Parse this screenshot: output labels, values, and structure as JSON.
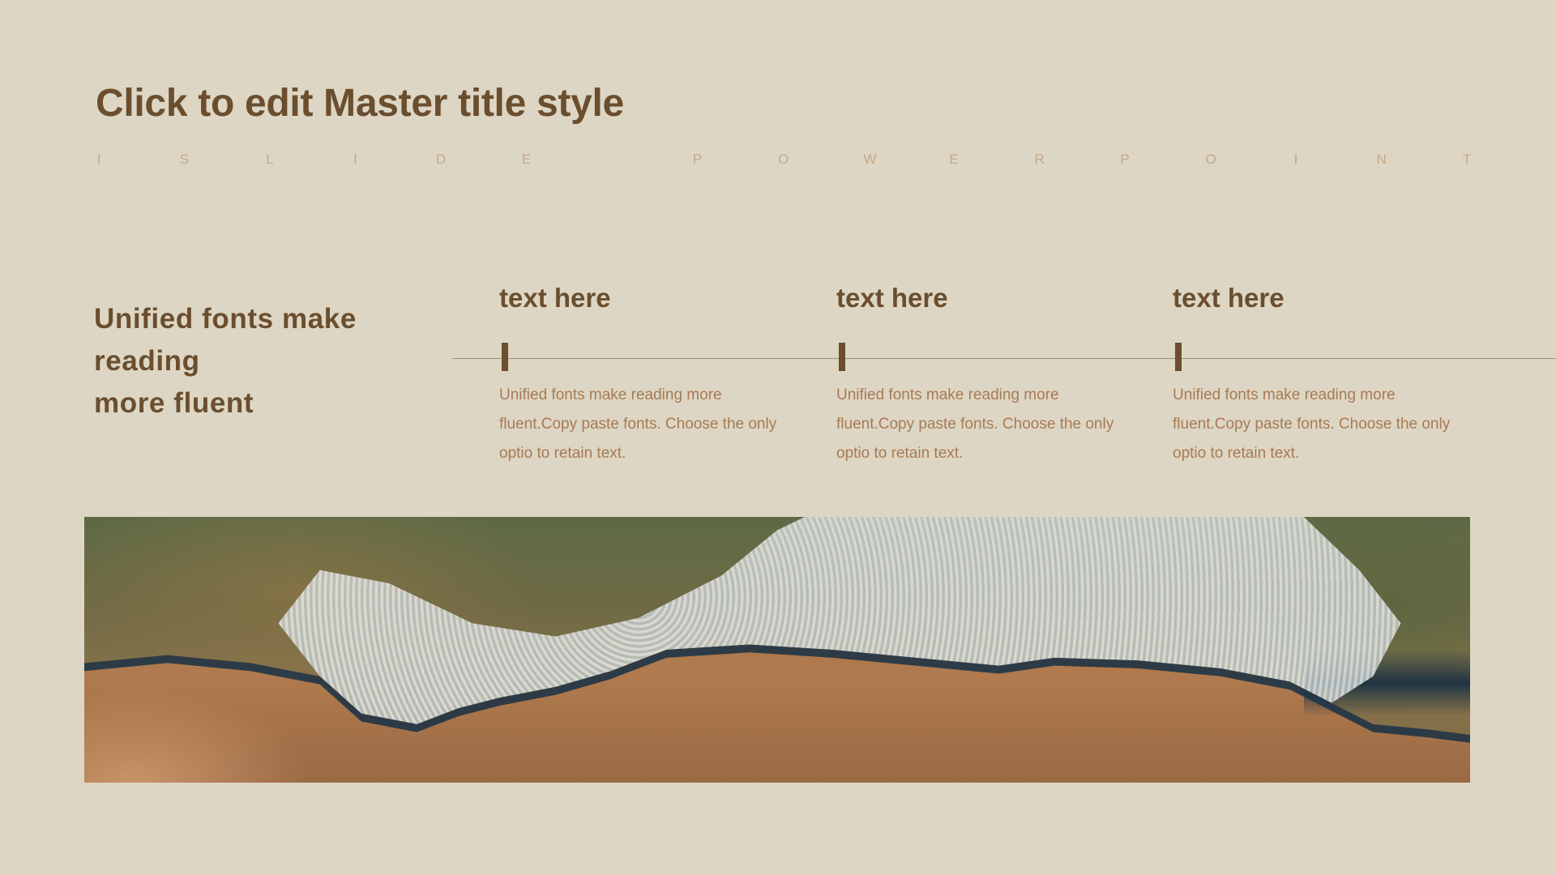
{
  "slide": {
    "title": "Click to edit Master title style",
    "subtitle_letters": [
      "I",
      "S",
      "L",
      "I",
      "D",
      "E",
      " ",
      "P",
      "O",
      "W",
      "E",
      "R",
      "P",
      "O",
      "I",
      "N",
      "T"
    ],
    "lead_lines": [
      "Unified fonts make",
      "reading",
      "more fluent"
    ],
    "columns": [
      {
        "heading": "text here",
        "body": "Unified  fonts make reading more fluent.Copy paste fonts. Choose the only optio to retain text."
      },
      {
        "heading": "text here",
        "body": "Unified  fonts make reading more fluent.Copy paste fonts. Choose the only optio to retain text."
      },
      {
        "heading": "text here",
        "body": "Unified  fonts make reading more fluent.Copy paste fonts. Choose the only optio to retain text."
      }
    ],
    "photo": {
      "subject": "aerial view of ocean wave breaking on sandy beach"
    },
    "colors": {
      "background": "#ddd6c4",
      "title": "#6b4e2e",
      "subtitle": "#c4a888",
      "body": "#a87a54",
      "rule": "#a08e72",
      "tick": "#6b4e2e"
    }
  }
}
